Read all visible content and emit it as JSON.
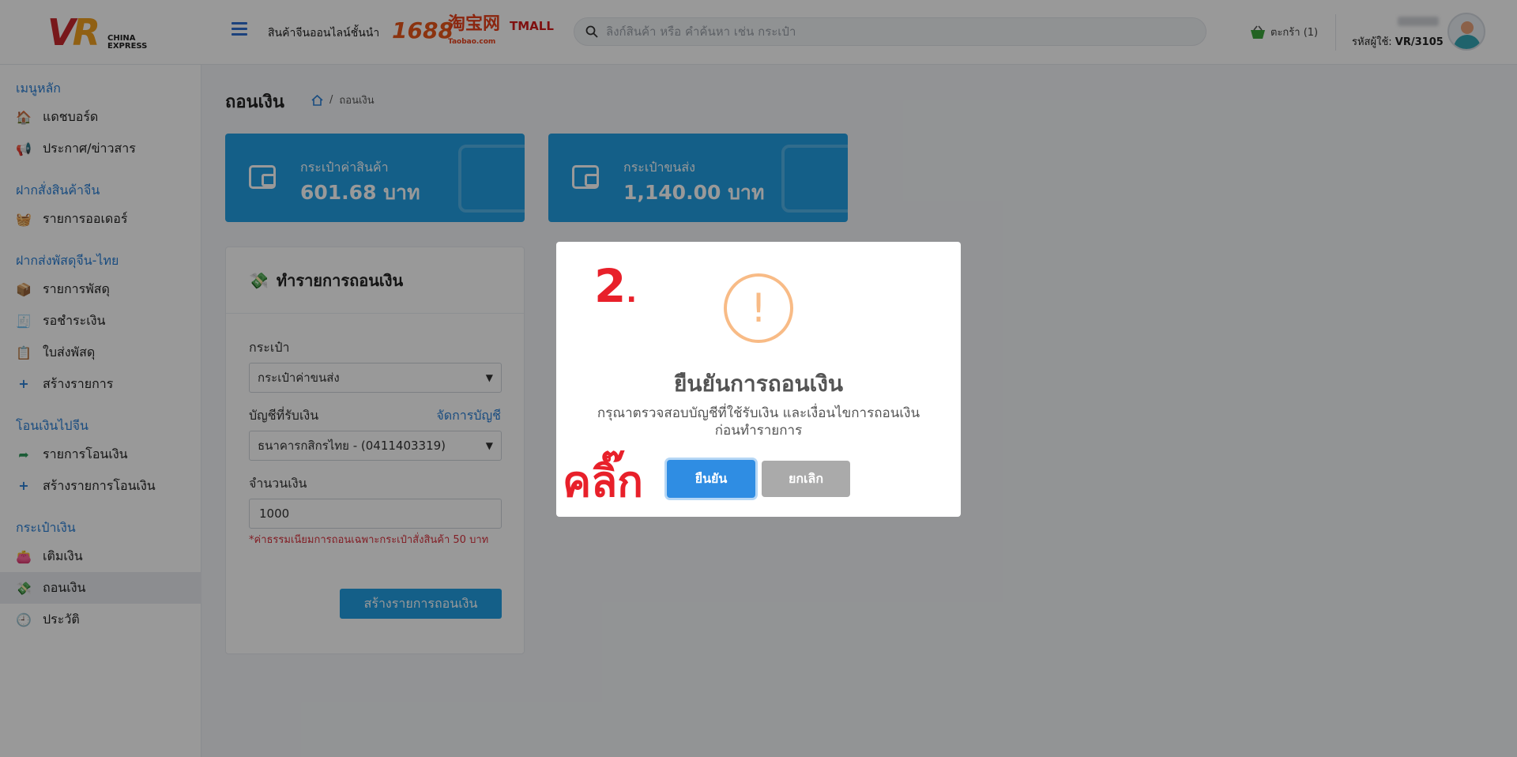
{
  "header": {
    "logo_brand": "VR",
    "logo_sub": "CHINA EXPRESS",
    "tagline": "สินค้าจีนออนไลน์ชั้นนำ",
    "brands": [
      "1688",
      "淘宝网",
      "Taobao.com",
      "TMALL"
    ],
    "search_placeholder": "ลิงก์สินค้า หรือ คำค้นหา เช่น กระเป๋า",
    "cart_label": "ตะกร้า (1)",
    "user_code_label": "รหัสผู้ใช้:",
    "user_code": "VR/3105"
  },
  "sidebar": {
    "sections": [
      {
        "title": "เมนูหลัก",
        "items": [
          {
            "label": "แดชบอร์ด",
            "icon": "house-icon"
          },
          {
            "label": "ประกาศ/ข่าวสาร",
            "icon": "megaphone-icon"
          }
        ]
      },
      {
        "title": "ฝากสั่งสินค้าจีน",
        "items": [
          {
            "label": "รายการออเดอร์",
            "icon": "basket-icon"
          }
        ]
      },
      {
        "title": "ฝากส่งพัสดุจีน-ไทย",
        "items": [
          {
            "label": "รายการพัสดุ",
            "icon": "box-icon"
          },
          {
            "label": "รอชำระเงิน",
            "icon": "cash-register-icon"
          },
          {
            "label": "ใบส่งพัสดุ",
            "icon": "clipboard-icon"
          },
          {
            "label": "สร้างรายการ",
            "icon": "plus-icon"
          }
        ]
      },
      {
        "title": "โอนเงินไปจีน",
        "items": [
          {
            "label": "รายการโอนเงิน",
            "icon": "share-arrow-icon"
          },
          {
            "label": "สร้างรายการโอนเงิน",
            "icon": "plus-icon"
          }
        ]
      },
      {
        "title": "กระเป๋าเงิน",
        "items": [
          {
            "label": "เติมเงิน",
            "icon": "wallet-icon"
          },
          {
            "label": "ถอนเงิน",
            "icon": "withdraw-icon",
            "active": true
          },
          {
            "label": "ประวัติ",
            "icon": "clock-icon"
          }
        ]
      }
    ]
  },
  "main": {
    "title": "ถอนเงิน",
    "breadcrumb": "ถอนเงิน",
    "wallets": [
      {
        "label": "กระเป๋าค่าสินค้า",
        "amount": "601.68 บาท"
      },
      {
        "label": "กระเป๋าขนส่ง",
        "amount": "1,140.00 บาท"
      }
    ],
    "form": {
      "title": "ทำรายการถอนเงิน",
      "wallet_label": "กระเป๋า",
      "wallet_value": "กระเป๋าค่าขนส่ง",
      "account_label": "บัญชีที่รับเงิน",
      "manage_link": "จัดการบัญชี",
      "account_value": "ธนาคารกสิกรไทย - (0411403319)",
      "amount_label": "จำนวนเงิน",
      "amount_value": "1000",
      "fee_note": "*ค่าธรรมเนียมการถอนเฉพาะกระเป๋าสั่งสินค้า 50 บาท",
      "submit_label": "สร้างรายการถอนเงิน"
    }
  },
  "modal": {
    "step": "2",
    "step_dot": ".",
    "title": "ยืนยันการถอนเงิน",
    "text": "กรุณาตรวจสอบบัญชีที่ใช้รับเงิน และเงื่อนไขการถอนเงิน ก่อนทำรายการ",
    "click_annotation": "คลิ๊ก",
    "confirm_label": "ยืนยัน",
    "cancel_label": "ยกเลิก"
  },
  "colors": {
    "accent": "#229fe3",
    "link": "#2a7fd5",
    "danger": "#d9333f",
    "annotation": "#e8202a",
    "warning": "#f8bb86"
  }
}
